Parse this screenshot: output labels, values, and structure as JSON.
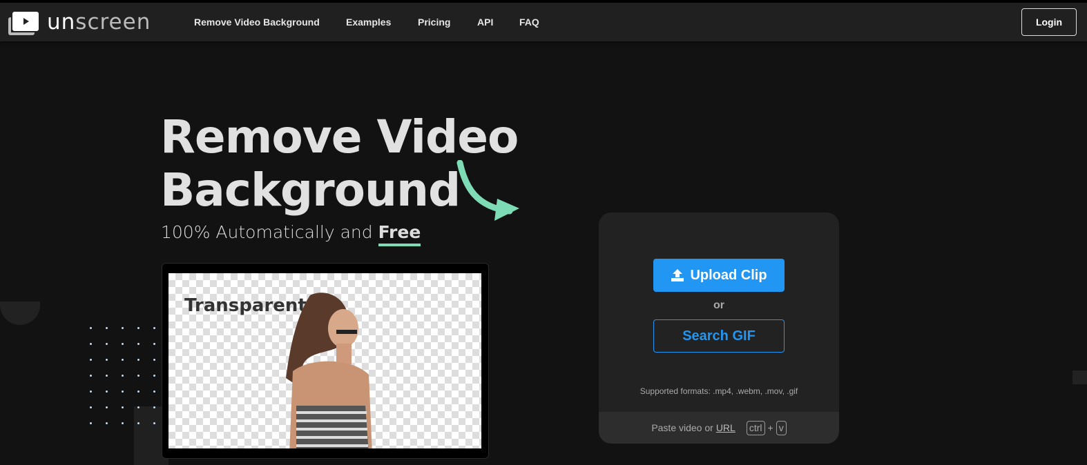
{
  "nav": {
    "logo_bold": "un",
    "logo_rest": "screen",
    "links": [
      "Remove Video Background",
      "Examples",
      "Pricing",
      "API",
      "FAQ"
    ],
    "login": "Login"
  },
  "hero": {
    "title_line1": "Remove Video",
    "title_line2": "Background",
    "subtitle_pre": "100% Automatically and ",
    "subtitle_free": "Free",
    "demo_label": "Transparent"
  },
  "card": {
    "upload": "Upload Clip",
    "or": "or",
    "search": "Search GIF",
    "formats": "Supported formats: .mp4, .webm, .mov, .gif",
    "paste_pre": "Paste video or ",
    "paste_link": "URL",
    "key1": "ctrl",
    "plus": "+",
    "key2": "v"
  },
  "colors": {
    "accent": "#2196f3",
    "highlight": "#7ddcb5"
  }
}
